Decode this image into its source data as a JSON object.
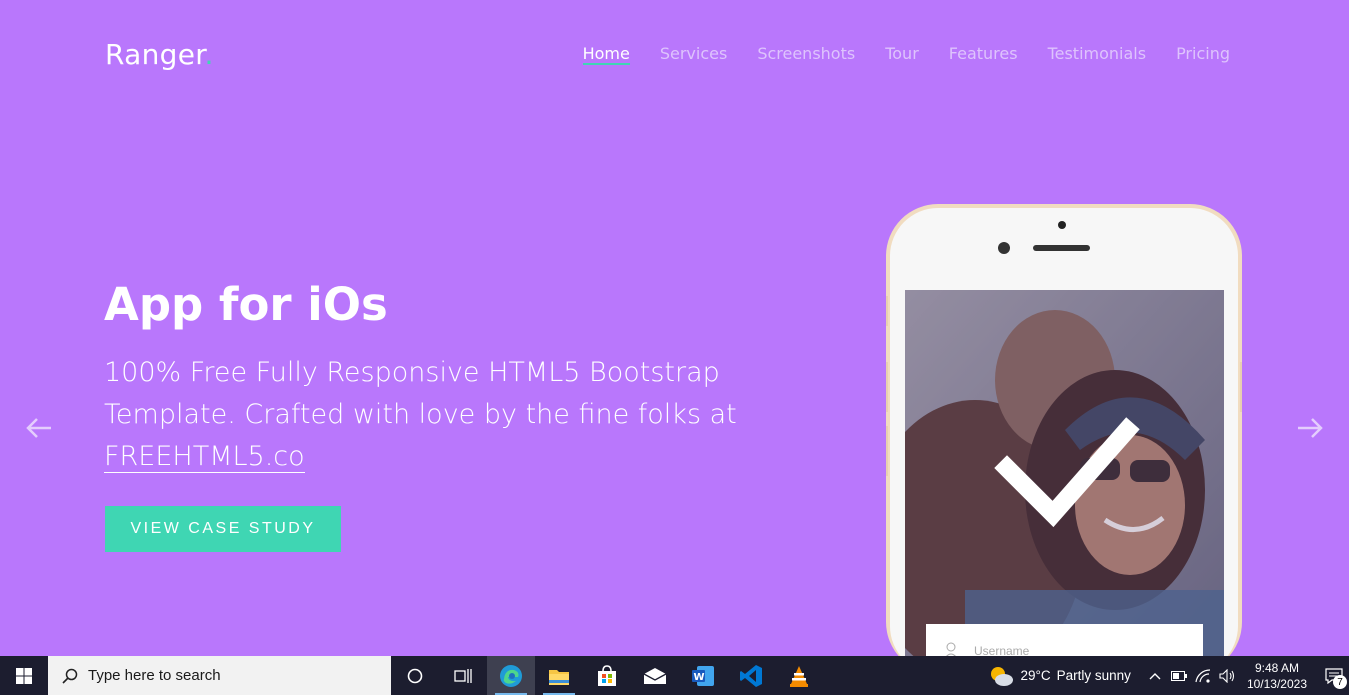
{
  "brand": {
    "name": "Ranger",
    "dot": ".",
    "accent": "#3fd6b3",
    "background": "#b977fc"
  },
  "nav": {
    "items": [
      "Home",
      "Services",
      "Screenshots",
      "Tour",
      "Features",
      "Testimonials",
      "Pricing"
    ],
    "active": "Home"
  },
  "hero": {
    "title": "App for iOs",
    "desc_text": "100% Free Fully Responsive HTML5 Bootstrap Template. Crafted with love by the fine folks at ",
    "desc_link": "FREEHTML5.co",
    "cta": "VIEW CASE STUDY"
  },
  "carousel": {
    "prev_icon": "arrow-left-icon",
    "next_icon": "arrow-right-icon"
  },
  "phone": {
    "username_placeholder": "Username"
  },
  "taskbar": {
    "search_placeholder": "Type here to search",
    "apps": [
      "cortana-icon",
      "task-view-icon",
      "edge-icon",
      "file-explorer-icon",
      "store-icon",
      "mail-icon",
      "word-icon",
      "vscode-icon",
      "vlc-icon"
    ],
    "weather_temp": "29°C",
    "weather_text": "Partly sunny",
    "time": "9:48 AM",
    "date": "10/13/2023",
    "notification_count": "7"
  }
}
